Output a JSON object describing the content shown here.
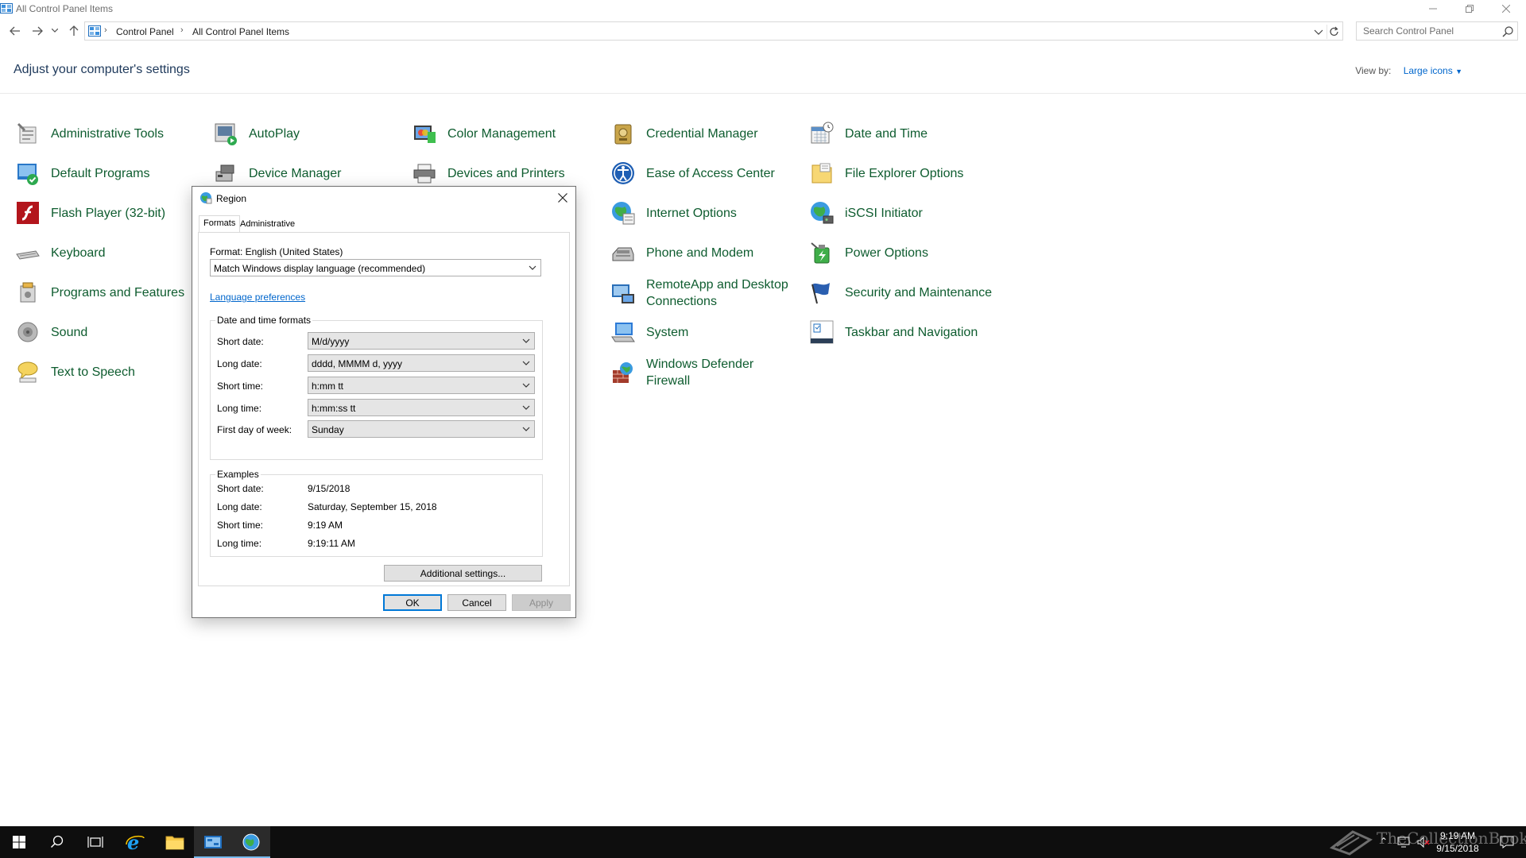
{
  "window": {
    "title": "All Control Panel Items",
    "breadcrumb": [
      "Control Panel",
      "All Control Panel Items"
    ],
    "search_placeholder": "Search Control Panel"
  },
  "header": {
    "heading": "Adjust your computer's settings",
    "view_by_label": "View by:",
    "view_by_value": "Large icons"
  },
  "items": [
    {
      "label": "Administrative Tools",
      "icon": "administrative-tools-icon"
    },
    {
      "label": "AutoPlay",
      "icon": "autoplay-icon"
    },
    {
      "label": "Color Management",
      "icon": "color-management-icon"
    },
    {
      "label": "Credential Manager",
      "icon": "credential-manager-icon"
    },
    {
      "label": "Date and Time",
      "icon": "date-time-icon"
    },
    {
      "label": "Default Programs",
      "icon": "default-programs-icon"
    },
    {
      "label": "Device Manager",
      "icon": "device-manager-icon"
    },
    {
      "label": "Devices and Printers",
      "icon": "devices-printers-icon"
    },
    {
      "label": "Ease of Access Center",
      "icon": "ease-of-access-icon"
    },
    {
      "label": "File Explorer Options",
      "icon": "file-explorer-options-icon"
    },
    {
      "label": "Flash Player (32-bit)",
      "icon": "flash-player-icon"
    },
    {
      "label": "Internet Options",
      "icon": "internet-options-icon"
    },
    {
      "label": "iSCSI Initiator",
      "icon": "iscsi-initiator-icon"
    },
    {
      "label": "Keyboard",
      "icon": "keyboard-icon"
    },
    {
      "label": "Phone and Modem",
      "icon": "phone-modem-icon"
    },
    {
      "label": "Power Options",
      "icon": "power-options-icon"
    },
    {
      "label": "Programs and Features",
      "icon": "programs-features-icon"
    },
    {
      "label": "RemoteApp and Desktop Connections",
      "icon": "remoteapp-icon"
    },
    {
      "label": "Security and Maintenance",
      "icon": "security-maintenance-icon"
    },
    {
      "label": "Sound",
      "icon": "sound-icon"
    },
    {
      "label": "System",
      "icon": "system-icon"
    },
    {
      "label": "Taskbar and Navigation",
      "icon": "taskbar-navigation-icon"
    },
    {
      "label": "Text to Speech",
      "icon": "text-to-speech-icon"
    },
    {
      "label": "Windows Defender Firewall",
      "icon": "firewall-icon"
    }
  ],
  "dialog": {
    "title": "Region",
    "tabs": [
      "Formats",
      "Administrative"
    ],
    "format_label": "Format: English (United States)",
    "format_value": "Match Windows display language (recommended)",
    "language_link": "Language preferences",
    "datetime_group": "Date and time formats",
    "fields": [
      {
        "label": "Short date:",
        "value": "M/d/yyyy"
      },
      {
        "label": "Long date:",
        "value": "dddd, MMMM d, yyyy"
      },
      {
        "label": "Short time:",
        "value": "h:mm tt"
      },
      {
        "label": "Long time:",
        "value": "h:mm:ss tt"
      },
      {
        "label": "First day of week:",
        "value": "Sunday"
      }
    ],
    "examples_group": "Examples",
    "examples": [
      {
        "label": "Short date:",
        "value": "9/15/2018"
      },
      {
        "label": "Long date:",
        "value": "Saturday, September 15, 2018"
      },
      {
        "label": "Short time:",
        "value": "9:19 AM"
      },
      {
        "label": "Long time:",
        "value": "9:19:11 AM"
      }
    ],
    "additional_button": "Additional settings...",
    "ok_button": "OK",
    "cancel_button": "Cancel",
    "apply_button": "Apply"
  },
  "taskbar": {
    "time": "9:19 AM",
    "date": "9/15/2018",
    "watermark": "TheCollectionBook",
    "accent_color": "#76b9ed"
  }
}
